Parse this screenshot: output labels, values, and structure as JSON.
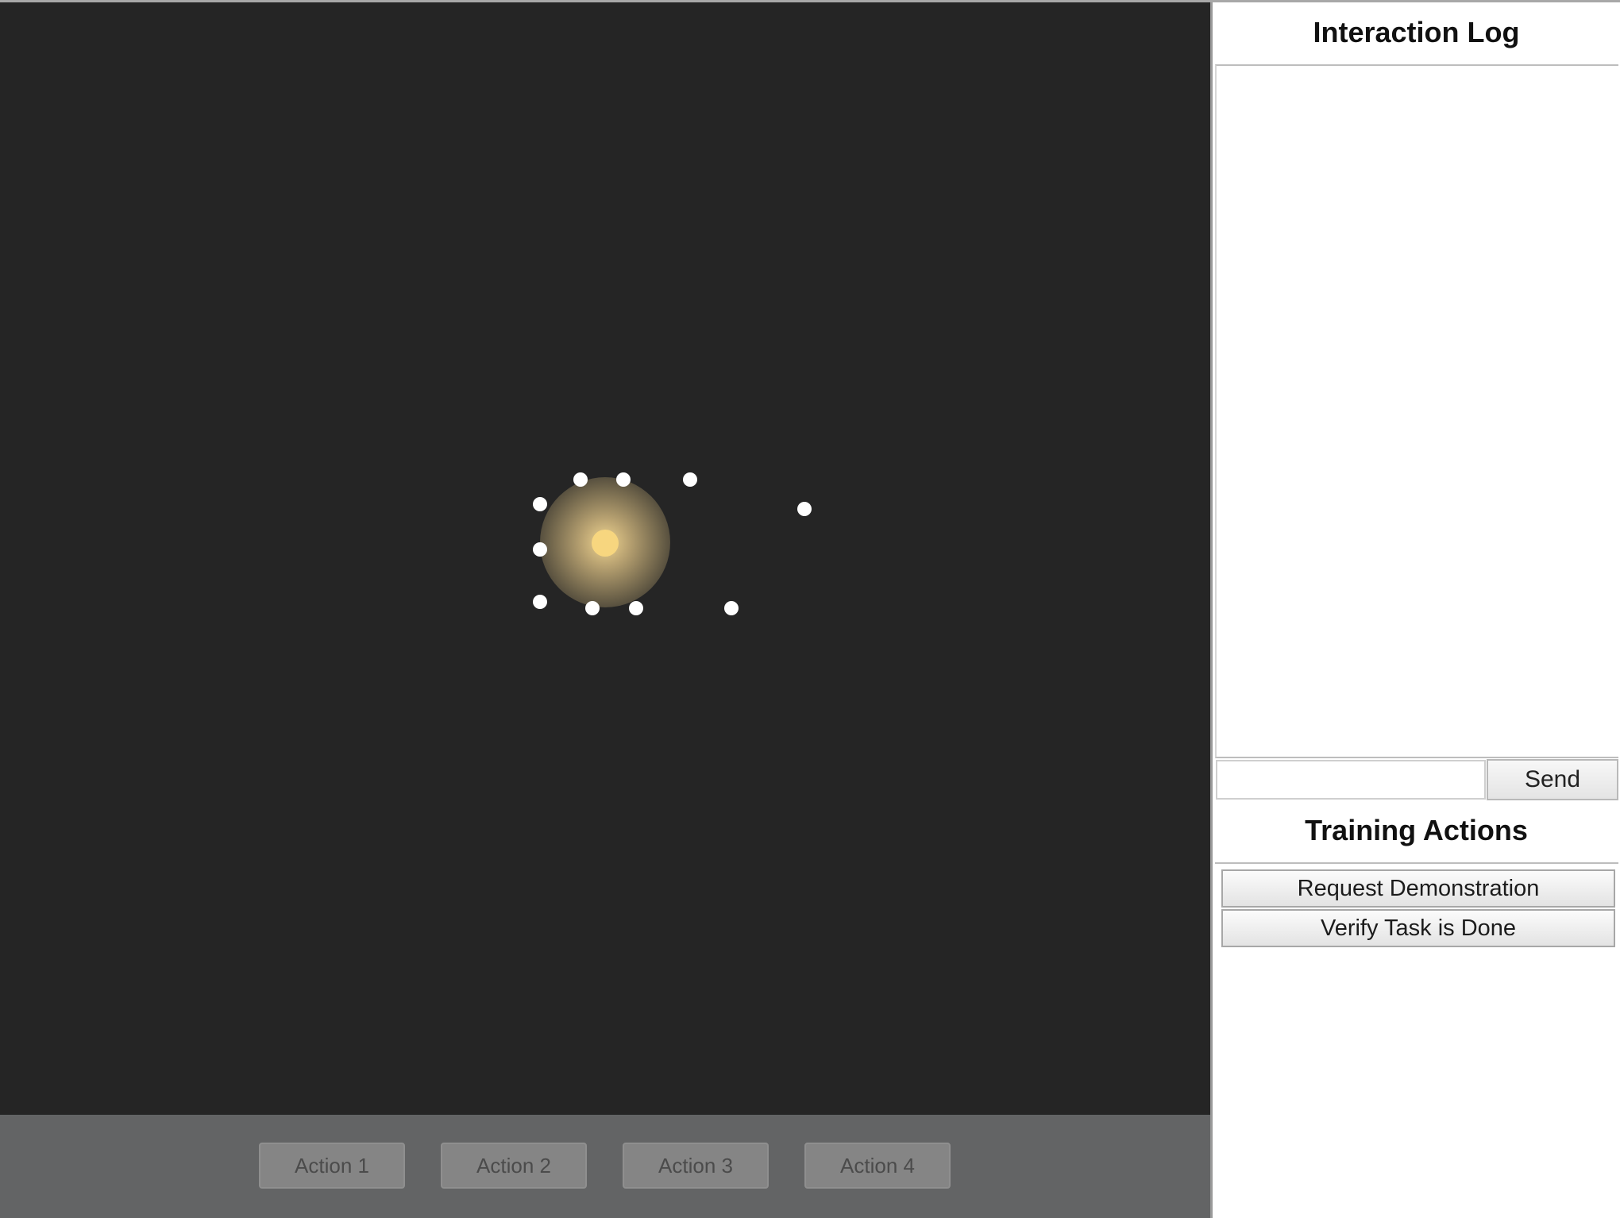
{
  "game": {
    "background_color": "#252525",
    "agent_color": "#f7d67f",
    "dot_color": "#ffffff",
    "actions": [
      "Action 1",
      "Action 2",
      "Action 3",
      "Action 4"
    ]
  },
  "sidebar": {
    "log_title": "Interaction Log",
    "message_input_value": "",
    "send_label": "Send",
    "training_title": "Training Actions",
    "training_buttons": [
      "Request Demonstration",
      "Verify Task is Done"
    ]
  }
}
